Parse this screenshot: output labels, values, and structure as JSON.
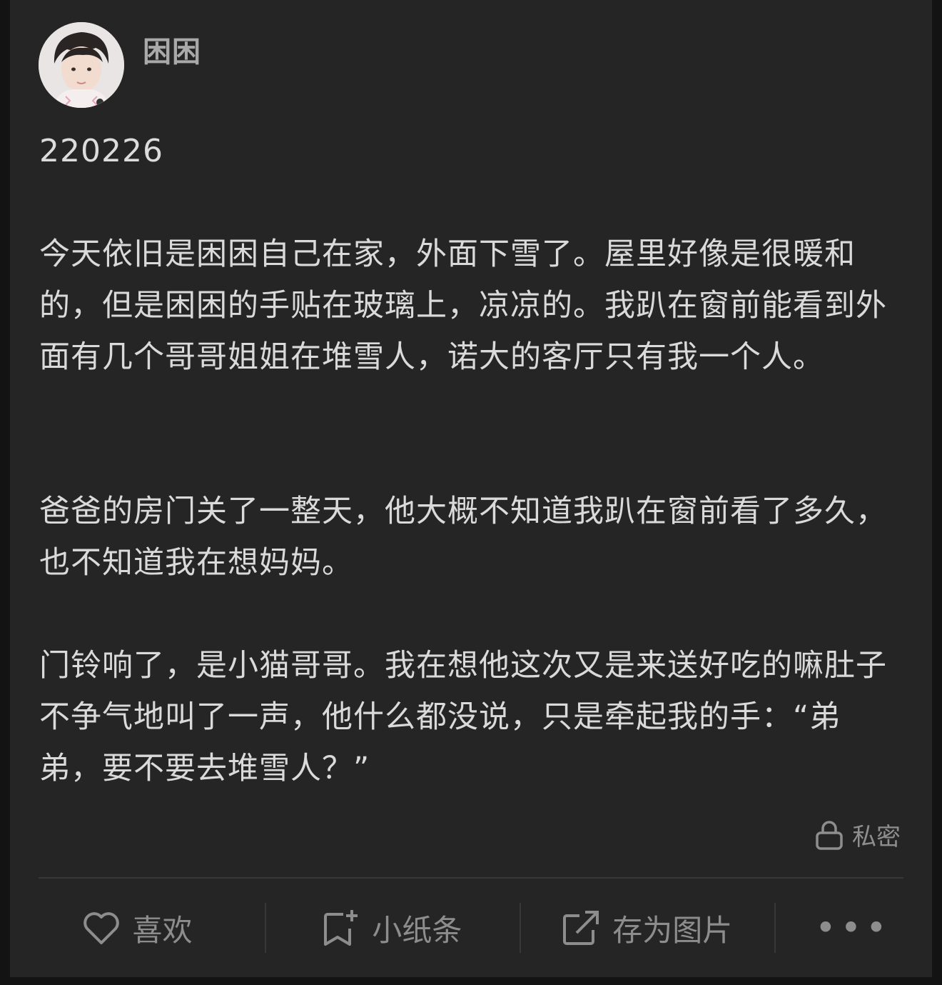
{
  "post": {
    "author": "困困",
    "date": "220226",
    "paragraphs": [
      "今天依旧是困困自己在家，外面下雪了。屋里好像是很暖和的，但是困困的手贴在玻璃上，凉凉的。我趴在窗前能看到外面有几个哥哥姐姐在堆雪人，诺大的客厅只有我一个人。",
      "爸爸的房门关了一整天，他大概不知道我趴在窗前看了多久，也不知道我在想妈妈。",
      "门铃响了，是小猫哥哥。我在想他这次又是来送好吃的嘛肚子不争气地叫了一声，他什么都没说，只是牵起我的手：“弟弟，要不要去堆雪人？”"
    ],
    "visibility_label": "私密"
  },
  "actions": {
    "like_label": "喜欢",
    "note_label": "小纸条",
    "save_image_label": "存为图片",
    "more_label": "•••"
  },
  "icons": [
    "lock-icon",
    "heart-icon",
    "note-add-icon",
    "share-icon",
    "more-icon"
  ],
  "colors": {
    "background": "#131313",
    "card": "#252525",
    "text": "#dadada",
    "muted": "#8d8d8d"
  }
}
